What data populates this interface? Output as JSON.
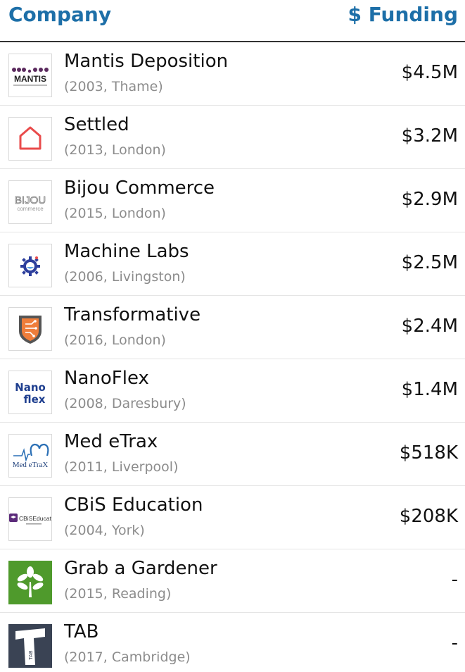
{
  "header": {
    "company_label": "Company",
    "funding_label": "$ Funding"
  },
  "colors": {
    "header_text": "#1d6fa8",
    "meta_text": "#8c8c8c"
  },
  "companies": [
    {
      "name": "Mantis Deposition",
      "year": "2003",
      "city": "Thame",
      "funding": "$4.5M",
      "logo_icon": "mantis-logo-icon",
      "logo_text": "MANTIS"
    },
    {
      "name": "Settled",
      "year": "2013",
      "city": "London",
      "funding": "$3.2M",
      "logo_icon": "house-outline-logo-icon"
    },
    {
      "name": "Bijou Commerce",
      "year": "2015",
      "city": "London",
      "funding": "$2.9M",
      "logo_icon": "bijou-wordmark-logo-icon",
      "logo_text": "BIJOU",
      "logo_subtext": "commerce"
    },
    {
      "name": "Machine Labs",
      "year": "2006",
      "city": "Livingston",
      "funding": "$2.5M",
      "logo_icon": "gear-flask-logo-icon"
    },
    {
      "name": "Transformative",
      "year": "2016",
      "city": "London",
      "funding": "$2.4M",
      "logo_icon": "shield-circuit-logo-icon"
    },
    {
      "name": "NanoFlex",
      "year": "2008",
      "city": "Daresbury",
      "funding": "$1.4M",
      "logo_icon": "nanoflex-wordmark-logo-icon",
      "logo_text": "Nano",
      "logo_subtext": "flex"
    },
    {
      "name": "Med eTrax",
      "year": "2011",
      "city": "Liverpool",
      "funding": "$518K",
      "logo_icon": "heartbeat-logo-icon",
      "logo_text": "Med eTraX"
    },
    {
      "name": "CBiS Education",
      "year": "2004",
      "city": "York",
      "funding": "$208K",
      "logo_icon": "graduation-cap-logo-icon",
      "logo_text": "CBiSEducation"
    },
    {
      "name": "Grab a Gardener",
      "year": "2015",
      "city": "Reading",
      "funding": "-",
      "logo_icon": "tree-logo-icon"
    },
    {
      "name": "TAB",
      "year": "2017",
      "city": "Cambridge",
      "funding": "-",
      "logo_icon": "tab-block-logo-icon",
      "logo_text": "TAB"
    }
  ]
}
